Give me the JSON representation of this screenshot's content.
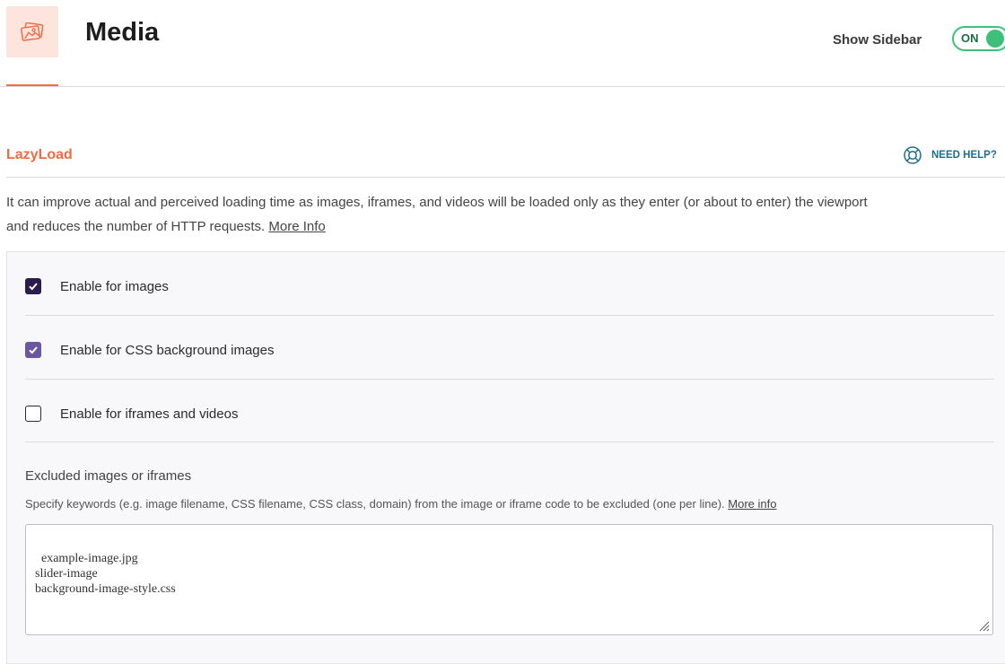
{
  "header": {
    "title": "Media",
    "icon": "images-icon",
    "show_sidebar_label": "Show Sidebar",
    "toggle_state": "ON"
  },
  "section": {
    "title": "LazyLoad",
    "help_label": "NEED HELP?",
    "description_line1": "It can improve actual and perceived loading time as images, iframes, and videos will be loaded only as they enter (or about to enter) the viewport",
    "description_line2": "and reduces the number of HTTP requests.",
    "more_info_label": "More Info"
  },
  "options": [
    {
      "label": "Enable for images",
      "checked": true
    },
    {
      "label": "Enable for CSS background images",
      "checked": true
    },
    {
      "label": "Enable for iframes and videos",
      "checked": false
    }
  ],
  "excluded": {
    "label": "Excluded images or iframes",
    "help_text": "Specify keywords (e.g. image filename, CSS filename, CSS class, domain) from the image or iframe code to be excluded (one per line).",
    "more_info_label": "More info",
    "value": "example-image.jpg\nslider-image\nbackground-image-style.css"
  },
  "colors": {
    "accent": "#f06a44",
    "toggle_green": "#3fc07a",
    "checkbox_dark": "#2c1c4a",
    "checkbox_purple": "#6a57a0",
    "help_blue": "#1d6f8c"
  }
}
